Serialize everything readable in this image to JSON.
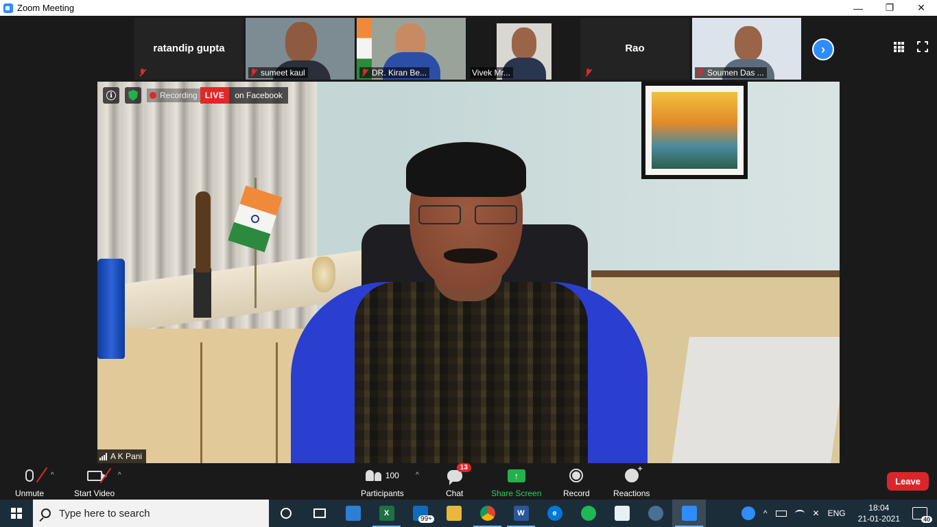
{
  "window": {
    "title": "Zoom Meeting"
  },
  "window_controls": {
    "minimize": "—",
    "restore": "❐",
    "close": "✕"
  },
  "participants_strip": [
    {
      "name": "ratandip gupta",
      "video": false,
      "muted": true
    },
    {
      "name": "sumeet kaul",
      "video": true,
      "muted": true
    },
    {
      "name": "DR. Kiran Be...",
      "video": true,
      "muted": true
    },
    {
      "name": "Vivek Mr...",
      "video": true,
      "muted": false
    },
    {
      "name": "Rao",
      "video": false,
      "muted": true
    },
    {
      "name": "Soumen Das ...",
      "video": true,
      "muted": true
    }
  ],
  "strip_next": "›",
  "main_video": {
    "speaker": "A K Pani",
    "recording_label": "Recording",
    "live_label": "LIVE",
    "live_destination": "on Facebook",
    "info_glyph": "i"
  },
  "toolbar": {
    "unmute": "Unmute",
    "start_video": "Start Video",
    "participants": "Participants",
    "participants_count": "100",
    "chat": "Chat",
    "chat_badge": "13",
    "share_screen": "Share Screen",
    "record": "Record",
    "reactions": "Reactions",
    "leave": "Leave",
    "caret": "^"
  },
  "taskbar": {
    "search_placeholder": "Type here to search",
    "mail_badge": "99+",
    "language": "ENG",
    "time": "18:04",
    "date": "21-01-2021",
    "notifications_count": "40"
  },
  "colors": {
    "zoom_blue": "#2d8cff",
    "live_red": "#e02828",
    "share_green": "#22b14c",
    "leave_red": "#d9262b",
    "taskbar": "#1c2d3a"
  }
}
